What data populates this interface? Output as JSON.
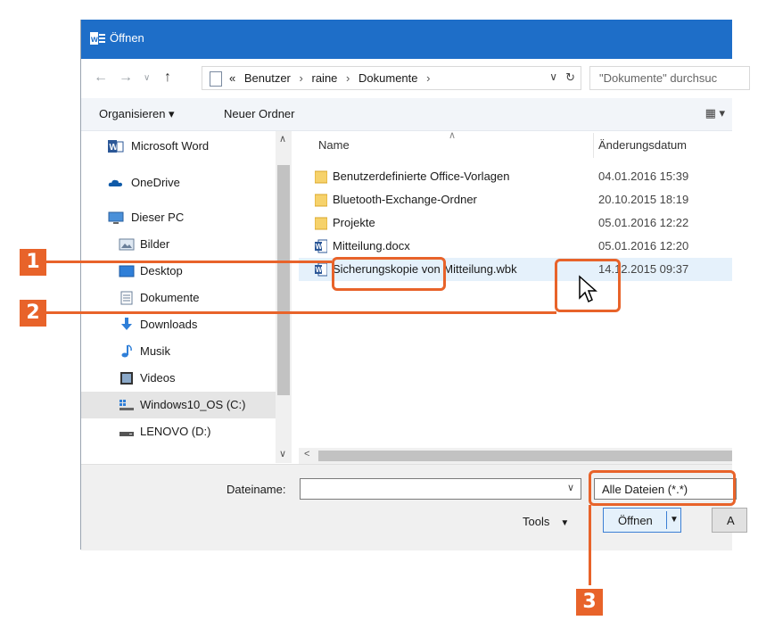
{
  "window": {
    "title": "Öffnen",
    "app_icon": "w"
  },
  "addressbar": {
    "back_icon": "←",
    "forward_icon": "→",
    "recent_icon": "∨",
    "up_icon": "↑",
    "prefix": "«",
    "crumbs": [
      "Benutzer",
      "raine",
      "Dokumente"
    ],
    "crumb_sep": "›",
    "dropdown_icon": "∨",
    "refresh_icon": "↻",
    "search_placeholder": "\"Dokumente\" durchsuc"
  },
  "toolbar": {
    "organize_label": "Organisieren ▾",
    "new_folder_label": "Neuer Ordner",
    "view_icon": "▦ ▾"
  },
  "nav": {
    "items": [
      {
        "label": "Microsoft Word",
        "icon": "word-icon"
      },
      {
        "label": "OneDrive",
        "icon": "cloud-icon"
      },
      {
        "label": "Dieser PC",
        "icon": "computer-icon"
      },
      {
        "label": "Bilder",
        "icon": "pictures-icon"
      },
      {
        "label": "Desktop",
        "icon": "desktop-icon"
      },
      {
        "label": "Dokumente",
        "icon": "documents-icon"
      },
      {
        "label": "Downloads",
        "icon": "download-icon"
      },
      {
        "label": "Musik",
        "icon": "music-icon"
      },
      {
        "label": "Videos",
        "icon": "video-icon"
      },
      {
        "label": "Windows10_OS (C:)",
        "icon": "drive-icon"
      },
      {
        "label": "LENOVO (D:)",
        "icon": "drive-icon"
      }
    ]
  },
  "filelist": {
    "col_name": "Name",
    "col_date": "Änderungsdatum",
    "rows": [
      {
        "name": "Benutzerdefinierte Office-Vorlagen",
        "date": "04.01.2016 15:39",
        "type": "folder"
      },
      {
        "name": "Bluetooth-Exchange-Ordner",
        "date": "20.10.2015 18:19",
        "type": "folder"
      },
      {
        "name": "Projekte",
        "date": "05.01.2016 12:22",
        "type": "folder"
      },
      {
        "name": "Mitteilung.docx",
        "date": "05.01.2016 12:20",
        "type": "word"
      },
      {
        "name": "Sicherungskopie von Mitteilung.wbk",
        "date": "14.12.2015 09:37",
        "type": "word"
      }
    ]
  },
  "bottom": {
    "filename_label": "Dateiname:",
    "filename_value": "",
    "filter_value": "Alle Dateien (*.*)",
    "tools_label": "Tools",
    "open_label": "Öffnen",
    "cancel_label": "A"
  },
  "callouts": {
    "badge1": "1",
    "badge2": "2",
    "badge3": "3",
    "color": "#e8632a"
  },
  "colors": {
    "titlebar": "#1e6ec8",
    "selection": "#e5f1fb",
    "accent": "#e8632a"
  }
}
